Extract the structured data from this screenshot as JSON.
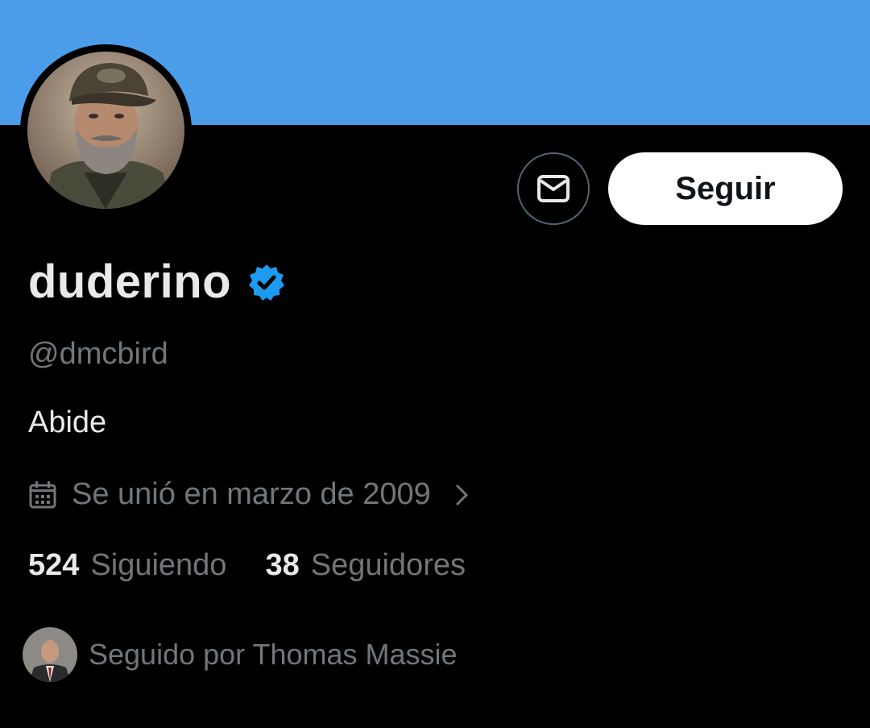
{
  "profile": {
    "display_name": "duderino",
    "handle": "@dmcbird",
    "bio": "Abide",
    "joined": "Se unió en marzo de 2009",
    "verified": true
  },
  "actions": {
    "follow_label": "Seguir",
    "message_icon": "mail-icon"
  },
  "stats": {
    "following_count": "524",
    "following_label": "Siguiendo",
    "followers_count": "38",
    "followers_label": "Seguidores"
  },
  "followed_by": {
    "text": "Seguido por Thomas Massie"
  },
  "colors": {
    "banner": "#4b9de9",
    "background": "#000000",
    "verified_badge": "#1d9bf0",
    "secondary_text": "#71767b"
  }
}
